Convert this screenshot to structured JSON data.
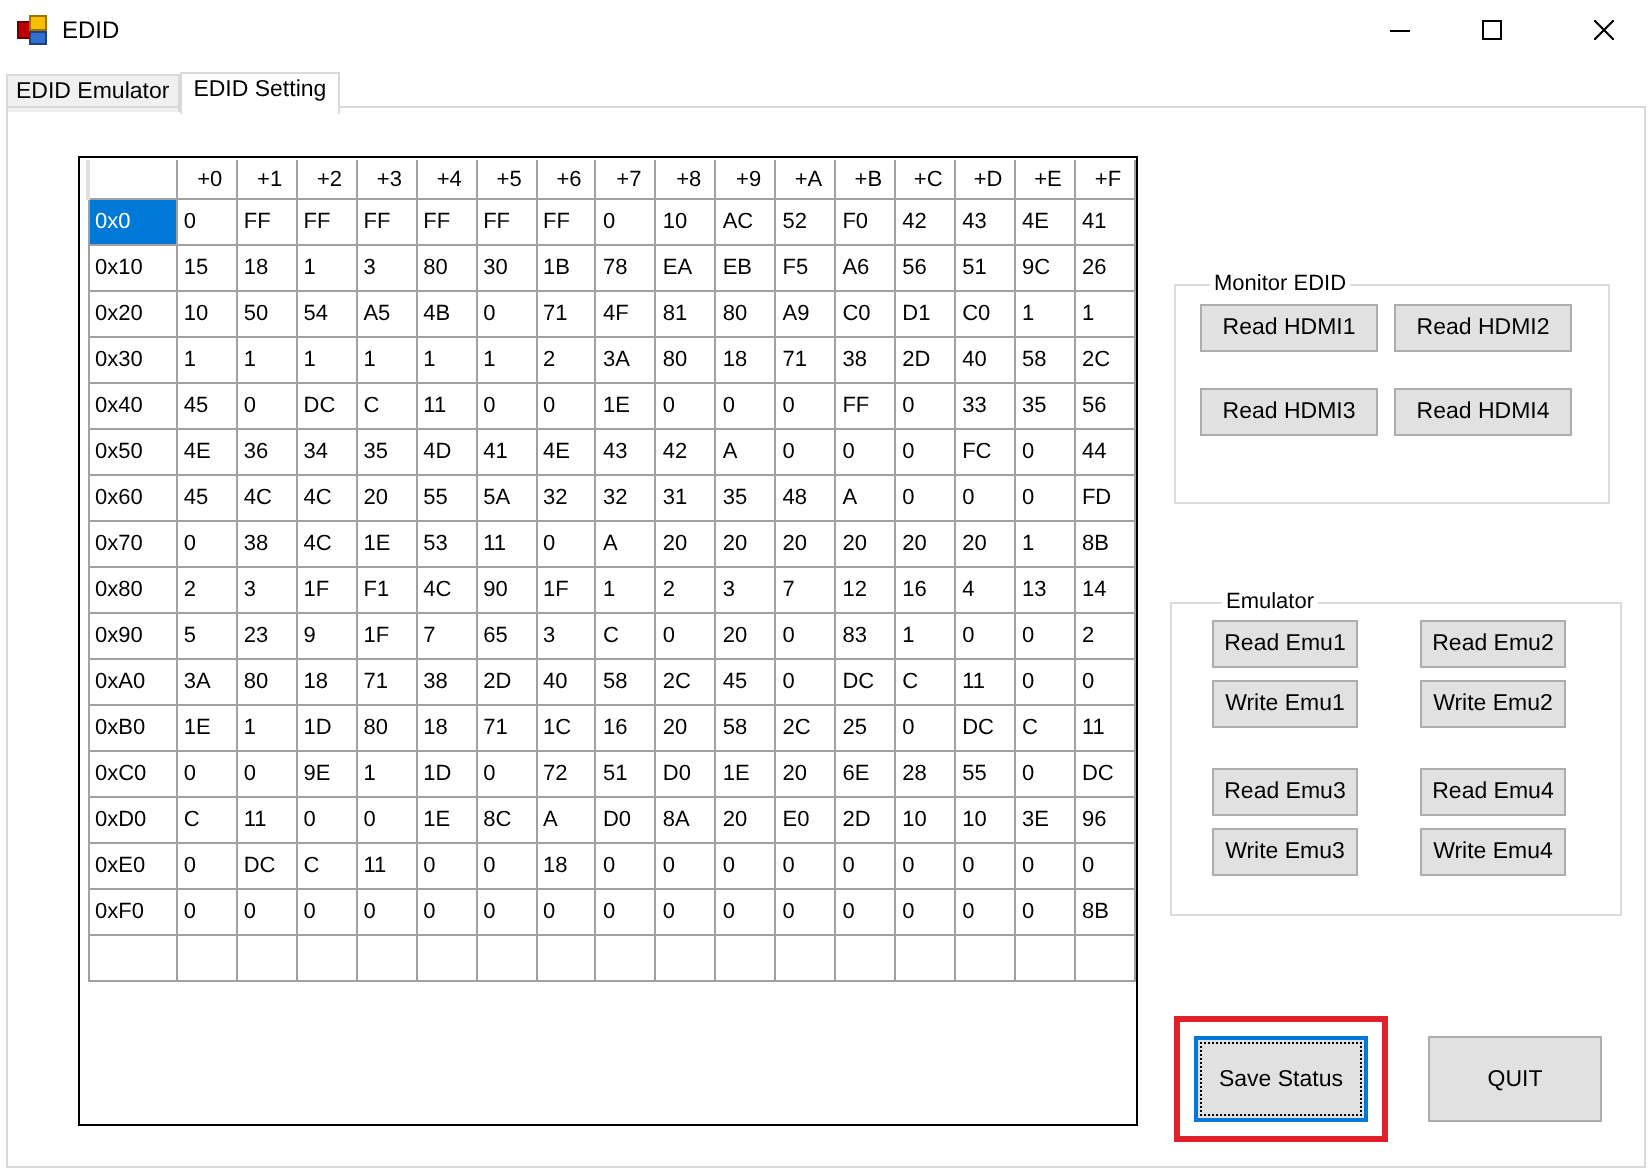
{
  "window": {
    "title": "EDID"
  },
  "tabs": [
    {
      "label": "EDID Emulator",
      "selected": false
    },
    {
      "label": "EDID Setting",
      "selected": true
    }
  ],
  "grid": {
    "columns": [
      "+0",
      "+1",
      "+2",
      "+3",
      "+4",
      "+5",
      "+6",
      "+7",
      "+8",
      "+9",
      "+A",
      "+B",
      "+C",
      "+D",
      "+E",
      "+F"
    ],
    "rows": [
      {
        "label": "0x0",
        "selected": true,
        "cells": [
          "0",
          "FF",
          "FF",
          "FF",
          "FF",
          "FF",
          "FF",
          "0",
          "10",
          "AC",
          "52",
          "F0",
          "42",
          "43",
          "4E",
          "41"
        ]
      },
      {
        "label": "0x10",
        "selected": false,
        "cells": [
          "15",
          "18",
          "1",
          "3",
          "80",
          "30",
          "1B",
          "78",
          "EA",
          "EB",
          "F5",
          "A6",
          "56",
          "51",
          "9C",
          "26"
        ]
      },
      {
        "label": "0x20",
        "selected": false,
        "cells": [
          "10",
          "50",
          "54",
          "A5",
          "4B",
          "0",
          "71",
          "4F",
          "81",
          "80",
          "A9",
          "C0",
          "D1",
          "C0",
          "1",
          "1"
        ]
      },
      {
        "label": "0x30",
        "selected": false,
        "cells": [
          "1",
          "1",
          "1",
          "1",
          "1",
          "1",
          "2",
          "3A",
          "80",
          "18",
          "71",
          "38",
          "2D",
          "40",
          "58",
          "2C"
        ]
      },
      {
        "label": "0x40",
        "selected": false,
        "cells": [
          "45",
          "0",
          "DC",
          "C",
          "11",
          "0",
          "0",
          "1E",
          "0",
          "0",
          "0",
          "FF",
          "0",
          "33",
          "35",
          "56"
        ]
      },
      {
        "label": "0x50",
        "selected": false,
        "cells": [
          "4E",
          "36",
          "34",
          "35",
          "4D",
          "41",
          "4E",
          "43",
          "42",
          "A",
          "0",
          "0",
          "0",
          "FC",
          "0",
          "44"
        ]
      },
      {
        "label": "0x60",
        "selected": false,
        "cells": [
          "45",
          "4C",
          "4C",
          "20",
          "55",
          "5A",
          "32",
          "32",
          "31",
          "35",
          "48",
          "A",
          "0",
          "0",
          "0",
          "FD"
        ]
      },
      {
        "label": "0x70",
        "selected": false,
        "cells": [
          "0",
          "38",
          "4C",
          "1E",
          "53",
          "11",
          "0",
          "A",
          "20",
          "20",
          "20",
          "20",
          "20",
          "20",
          "1",
          "8B"
        ]
      },
      {
        "label": "0x80",
        "selected": false,
        "cells": [
          "2",
          "3",
          "1F",
          "F1",
          "4C",
          "90",
          "1F",
          "1",
          "2",
          "3",
          "7",
          "12",
          "16",
          "4",
          "13",
          "14"
        ]
      },
      {
        "label": "0x90",
        "selected": false,
        "cells": [
          "5",
          "23",
          "9",
          "1F",
          "7",
          "65",
          "3",
          "C",
          "0",
          "20",
          "0",
          "83",
          "1",
          "0",
          "0",
          "2"
        ]
      },
      {
        "label": "0xA0",
        "selected": false,
        "cells": [
          "3A",
          "80",
          "18",
          "71",
          "38",
          "2D",
          "40",
          "58",
          "2C",
          "45",
          "0",
          "DC",
          "C",
          "11",
          "0",
          "0"
        ]
      },
      {
        "label": "0xB0",
        "selected": false,
        "cells": [
          "1E",
          "1",
          "1D",
          "80",
          "18",
          "71",
          "1C",
          "16",
          "20",
          "58",
          "2C",
          "25",
          "0",
          "DC",
          "C",
          "11"
        ]
      },
      {
        "label": "0xC0",
        "selected": false,
        "cells": [
          "0",
          "0",
          "9E",
          "1",
          "1D",
          "0",
          "72",
          "51",
          "D0",
          "1E",
          "20",
          "6E",
          "28",
          "55",
          "0",
          "DC"
        ]
      },
      {
        "label": "0xD0",
        "selected": false,
        "cells": [
          "C",
          "11",
          "0",
          "0",
          "1E",
          "8C",
          "A",
          "D0",
          "8A",
          "20",
          "E0",
          "2D",
          "10",
          "10",
          "3E",
          "96"
        ]
      },
      {
        "label": "0xE0",
        "selected": false,
        "cells": [
          "0",
          "DC",
          "C",
          "11",
          "0",
          "0",
          "18",
          "0",
          "0",
          "0",
          "0",
          "0",
          "0",
          "0",
          "0",
          "0"
        ]
      },
      {
        "label": "0xF0",
        "selected": false,
        "cells": [
          "0",
          "0",
          "0",
          "0",
          "0",
          "0",
          "0",
          "0",
          "0",
          "0",
          "0",
          "0",
          "0",
          "0",
          "0",
          "8B"
        ]
      }
    ]
  },
  "monitor_edid": {
    "title": "Monitor EDID",
    "button_rows": [
      [
        "Read HDMI1",
        "Read HDMI2"
      ],
      [
        "Read HDMI3",
        "Read HDMI4"
      ]
    ]
  },
  "emulator": {
    "title": "Emulator",
    "button_rows": [
      [
        "Read Emu1",
        "Read Emu2"
      ],
      [
        "Write Emu1",
        "Write Emu2"
      ],
      [
        "Read Emu3",
        "Read Emu4"
      ],
      [
        "Write Emu3",
        "Write Emu4"
      ]
    ]
  },
  "actions": [
    {
      "label": "Save Status",
      "focused": true,
      "highlighted": true
    },
    {
      "label": "QUIT",
      "focused": false,
      "highlighted": false
    }
  ]
}
